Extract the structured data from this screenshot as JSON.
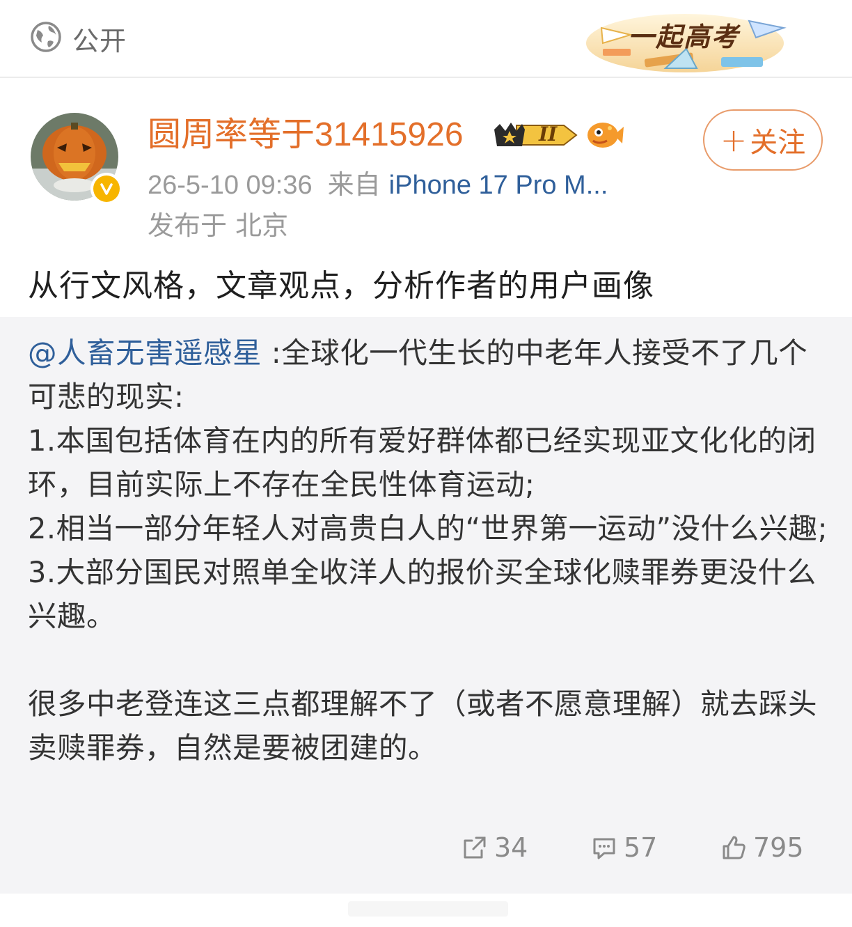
{
  "topbar": {
    "visibility_label": "公开",
    "banner_text": "一起高考"
  },
  "author": {
    "name": "圆周率等于31415926",
    "level_badge": "II",
    "verified": true
  },
  "meta": {
    "timestamp": "26-5-10 09:36",
    "source_prefix": "来自",
    "device": "iPhone 17 Pro M...",
    "location": "发布于 北京"
  },
  "follow_button": {
    "plus": "+",
    "label": "关注"
  },
  "post": {
    "text": "从行文风格，文章观点，分析作者的用户画像"
  },
  "repost": {
    "mention": "@人畜无害遥感星",
    "line1": " :全球化一代生长的中老年人接受不了几个可悲的现实:",
    "item1": "1.本国包括体育在内的所有爱好群体都已经实现亚文化化的闭环，目前实际上不存在全民性体育运动;",
    "item2": "2.相当一部分年轻人对高贵白人的“世界第一运动”没什么兴趣;",
    "item3": "3.大部分国民对照单全收洋人的报价买全球化赎罪券更没什么兴趣。",
    "closing": "很多中老登连这三点都理解不了（或者不愿意理解）就去踩头卖赎罪券，自然是要被团建的。"
  },
  "actions": {
    "repost_count": "34",
    "comment_count": "57",
    "like_count": "795"
  },
  "colors": {
    "username": "#e36f2a",
    "link": "#2f5f9a",
    "repost_bg": "#f4f4f6",
    "meta": "#9a9a9a"
  }
}
